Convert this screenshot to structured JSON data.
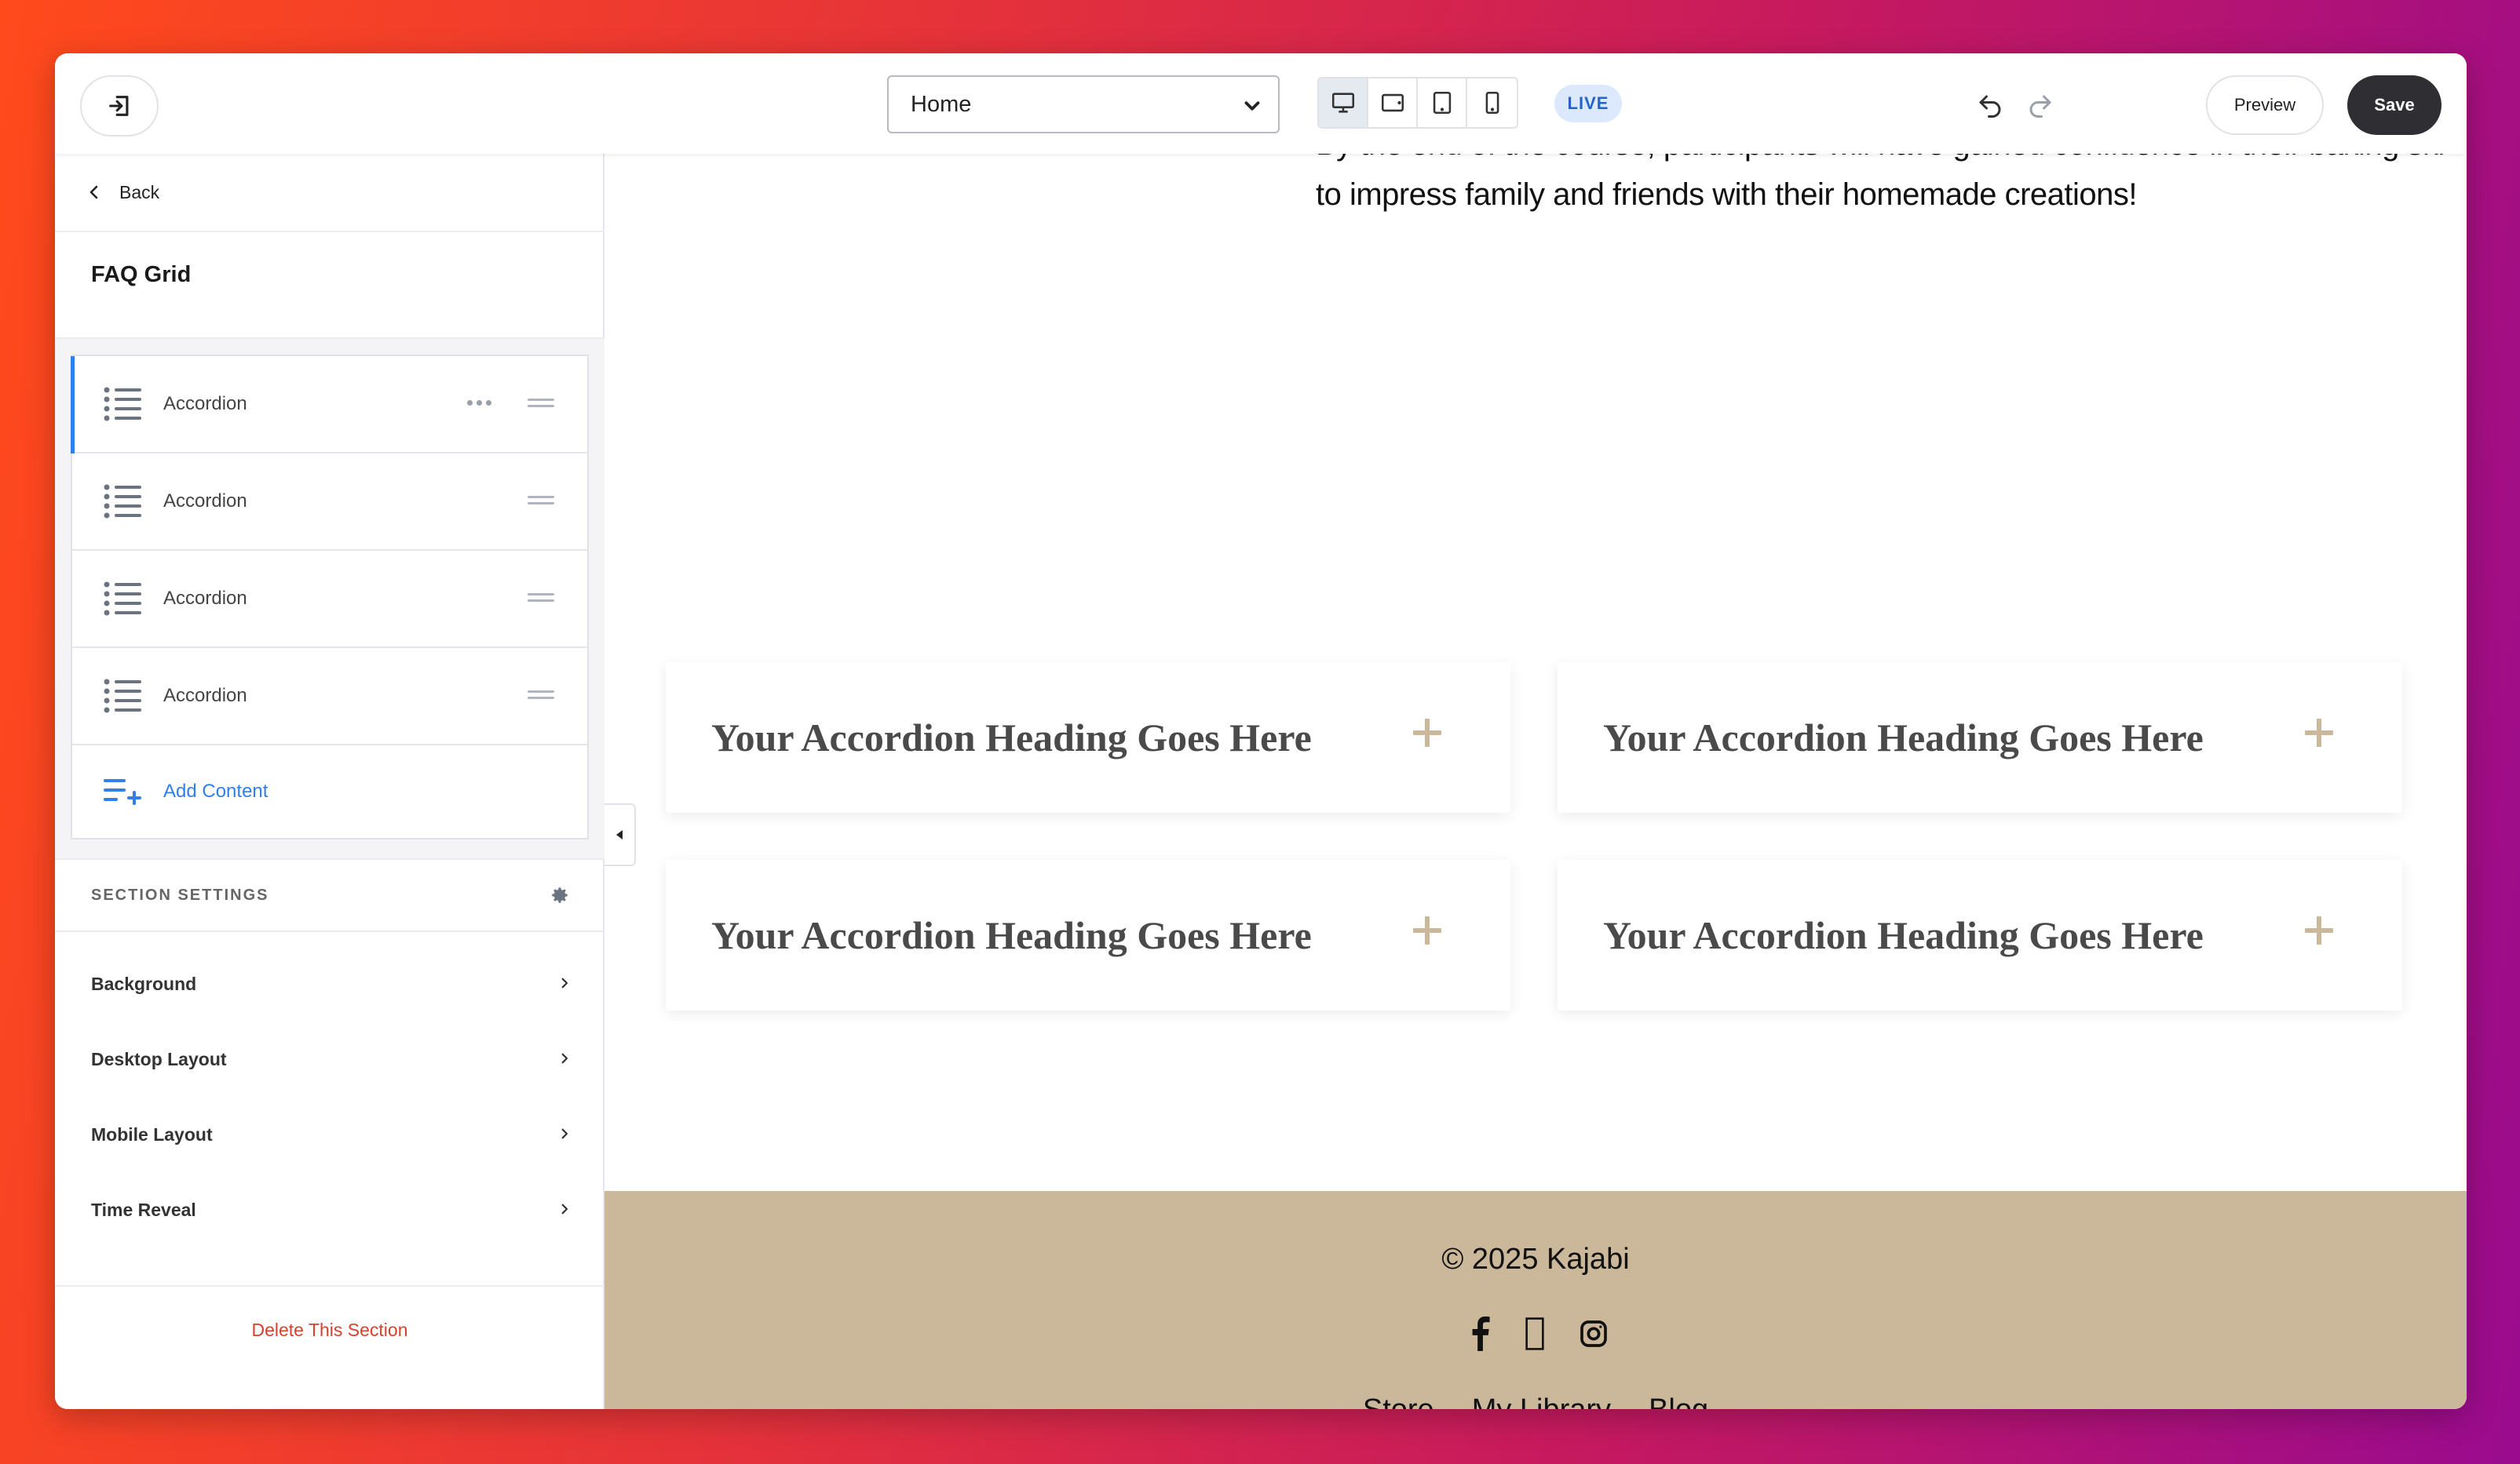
{
  "topbar": {
    "page_select": "Home",
    "live_label": "LIVE",
    "preview_label": "Preview",
    "save_label": "Save"
  },
  "sidebar": {
    "back_label": "Back",
    "section_title": "FAQ Grid",
    "blocks": [
      {
        "label": "Accordion"
      },
      {
        "label": "Accordion"
      },
      {
        "label": "Accordion"
      },
      {
        "label": "Accordion"
      }
    ],
    "add_content_label": "Add Content",
    "settings_heading": "SECTION SETTINGS",
    "settings": [
      {
        "label": "Background"
      },
      {
        "label": "Desktop Layout"
      },
      {
        "label": "Mobile Layout"
      },
      {
        "label": "Time Reveal"
      }
    ],
    "delete_label": "Delete This Section"
  },
  "canvas": {
    "paragraph_line1": "By the end of the course, participants will have gained confidence in their baking skills and be ready",
    "paragraph_line2": "to impress family and friends with their homemade creations!",
    "faq_items": [
      {
        "heading": "Your Accordion Heading Goes Here"
      },
      {
        "heading": "Your Accordion Heading Goes Here"
      },
      {
        "heading": "Your Accordion Heading Goes Here"
      },
      {
        "heading": "Your Accordion Heading Goes Here"
      }
    ],
    "footer": {
      "copyright": "© 2025 Kajabi",
      "links": [
        "Store",
        "My Library",
        "Blog"
      ]
    }
  },
  "colors": {
    "accent_blue": "#2f80ed",
    "footer_bg": "#cbb89a",
    "plus_color": "#cbb89a",
    "delete_red": "#d8402f",
    "save_bg": "#2f2f33"
  }
}
